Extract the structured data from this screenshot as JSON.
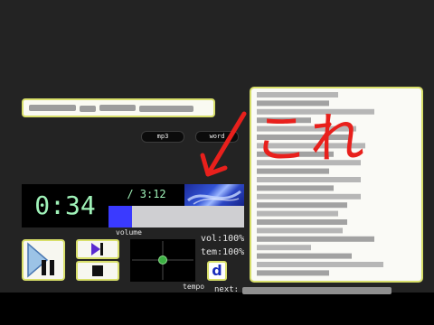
{
  "player": {
    "title_obscured": true,
    "buttons": {
      "mp3": "mp3",
      "word": "word"
    },
    "time": {
      "current": "0:34",
      "total": "/ 3:12"
    },
    "progress": 0.17,
    "labels": {
      "volume": "volume",
      "tempo": "tempo",
      "next": "next:"
    },
    "stats": {
      "vol": "vol:100%",
      "tem": "tem:100%"
    },
    "d_button": "d",
    "lyrics_obscured": true
  },
  "annotation": {
    "text": "これ"
  },
  "colors": {
    "background": "#232323",
    "panel_border": "#d8df6a",
    "time_text": "#9ff2b8",
    "progress_fill": "#3a3aff",
    "annotation_red": "#e8201c"
  }
}
